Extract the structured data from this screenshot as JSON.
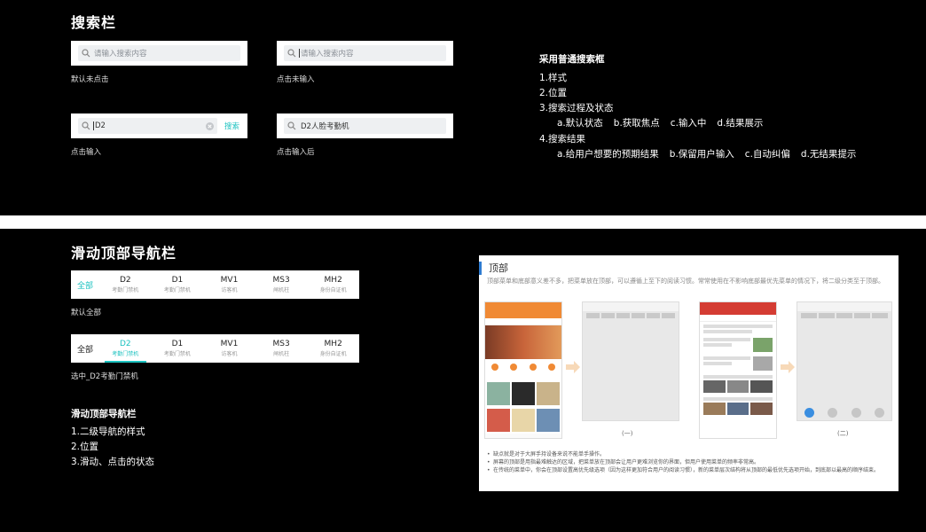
{
  "search_section": {
    "title": "搜索栏",
    "boxes": [
      {
        "placeholder": "请输入搜索内容",
        "caption": "默认未点击"
      },
      {
        "placeholder": "请输入搜索内容",
        "caption": "点击未输入"
      },
      {
        "value": "D2",
        "action": "搜索",
        "caption": "点击输入"
      },
      {
        "value": "D2人脸考勤机",
        "caption": "点击输入后"
      }
    ],
    "notes": {
      "heading": "采用普通搜索框",
      "item1": "1.样式",
      "item2": "2.位置",
      "item3": "3.搜索过程及状态",
      "item3_sub": [
        "a.默认状态",
        "b.获取焦点",
        "c.输入中",
        "d.结果展示"
      ],
      "item4": "4.搜索结果",
      "item4_sub": [
        "a.给用户想要的预期结果",
        "b.保留用户输入",
        "c.自动纠偏",
        "d.无结果提示"
      ]
    }
  },
  "nav_section": {
    "title": "滑动顶部导航栏",
    "tabs": [
      {
        "label": "全部",
        "sub": ""
      },
      {
        "label": "D2",
        "sub": "考勤门禁机"
      },
      {
        "label": "D1",
        "sub": "考勤门禁机"
      },
      {
        "label": "MV1",
        "sub": "访客机"
      },
      {
        "label": "MS3",
        "sub": "闸机柱"
      },
      {
        "label": "MH2",
        "sub": "身份自证机"
      }
    ],
    "caption_default": "默认全部",
    "caption_selected": "选中_D2考勤门禁机",
    "notes": {
      "heading": "滑动顶部导航栏",
      "item1": "1.二级导航的样式",
      "item2": "2.位置",
      "item3": "3.滑动、点击的状态"
    }
  },
  "reference_card": {
    "title": "顶部",
    "desc": "顶部菜单和底部意义差不多，把菜单放在顶部，可以遵循上至下的阅读习惯。常常使用在不影响底部最优先菜单的情况下，将二级分类至于顶部。",
    "label_one": "(一)",
    "label_two": "(二)",
    "bullets": [
      "缺点就是对于大屏手持设备来说不能单手操作。",
      "屏幕的顶部是用指最难触达的区域，把菜单放在顶部会让用户更难浏览你的界面，但用户使用菜单的频率非常高。",
      "在传统的菜单中，你会在顶部设置高优先级选项（因为这样更加符合用户的阅读习惯），新的菜单层次结构将从顶部的最低优先选项开始，到底部以最高的顺序结束。"
    ]
  },
  "colors": {
    "accent": "#1cc2c0",
    "card_accent": "#2e7bd1"
  }
}
